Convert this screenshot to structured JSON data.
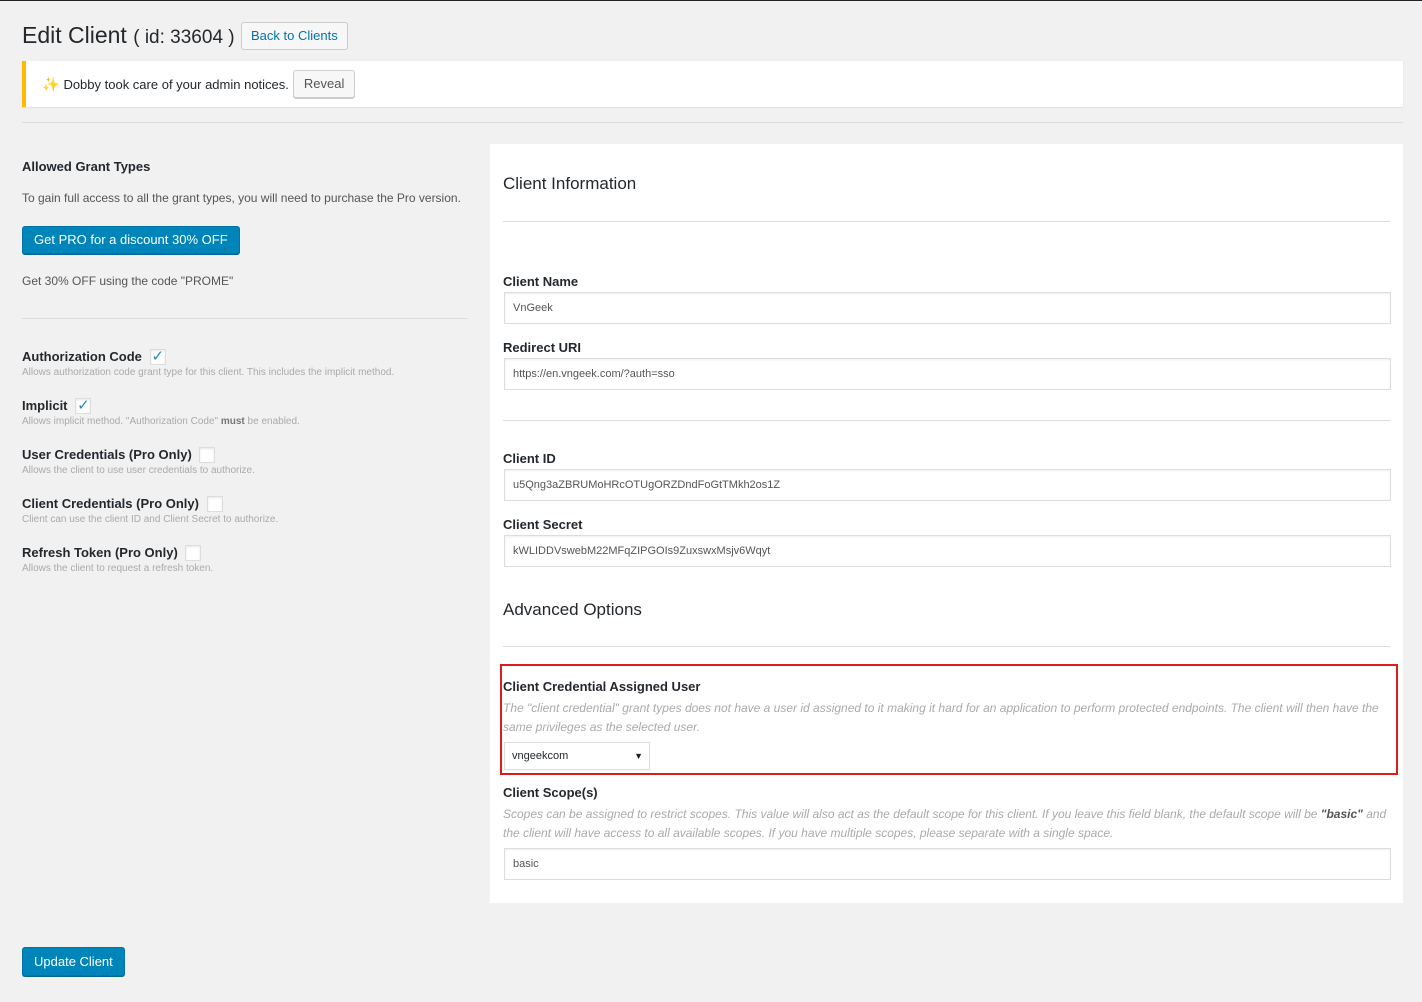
{
  "header": {
    "title": "Edit Client",
    "id_text": "( id: 33604 )",
    "back_label": "Back to Clients"
  },
  "notice": {
    "icon": "sparkle-icon",
    "text": "Dobby took care of your admin notices.",
    "reveal_label": "Reveal",
    "accent": "#ffb900"
  },
  "grants": {
    "heading": "Allowed Grant Types",
    "pro_desc": "To gain full access to all the grant types, you will need to purchase the Pro version.",
    "pro_button": "Get PRO for a discount 30% OFF",
    "pro_dot": ".",
    "pro_code": "Get 30% OFF using the code \"PROME\"",
    "items": [
      {
        "label": "Authorization Code",
        "checked": true,
        "desc": "Allows authorization code grant type for this client. This includes the implicit method."
      },
      {
        "label": "Implicit",
        "checked": true,
        "desc_pre": "Allows implicit method. \"Authorization Code\" ",
        "desc_bold": "must",
        "desc_post": " be enabled."
      },
      {
        "label": "User Credentials (Pro Only)",
        "checked": false,
        "desc": "Allows the client to use user credentials to authorize."
      },
      {
        "label": "Client Credentials (Pro Only)",
        "checked": false,
        "desc": "Client can use the client ID and Client Secret to authorize."
      },
      {
        "label": "Refresh Token (Pro Only)",
        "checked": false,
        "desc": "Allows the client to request a refresh token."
      }
    ]
  },
  "client_info": {
    "title": "Client Information",
    "name_label": "Client Name",
    "name_value": "VnGeek",
    "redirect_label": "Redirect URI",
    "redirect_value": "https://en.vngeek.com/?auth=sso",
    "id_label": "Client ID",
    "id_value": "u5Qng3aZBRUMoHRcOTUgORZDndFoGtTMkh2os1Z",
    "secret_label": "Client Secret",
    "secret_value": "kWLIDDVswebM22MFqZIPGOIs9ZuxswxMsjv6Wqyt"
  },
  "advanced": {
    "title": "Advanced Options",
    "assigned_label": "Client Credential Assigned User",
    "assigned_help": "The \"client credential\" grant types does not have a user id assigned to it making it hard for an application to perform protected endpoints. The client will then have the same privileges as the selected user.",
    "assigned_value": "vngeekcom",
    "scope_label": "Client Scope(s)",
    "scope_help_pre": "Scopes can be assigned to restrict scopes. This value will also act as the default scope for this client. If you leave this field blank, the default scope will be ",
    "scope_help_bold": "\"basic\"",
    "scope_help_post": " and the client will have access to all available scopes. If you have multiple scopes, please separate with a single space.",
    "scope_value": "basic",
    "highlight_color": "#dd1c1c"
  },
  "footer": {
    "update_label": "Update Client"
  }
}
